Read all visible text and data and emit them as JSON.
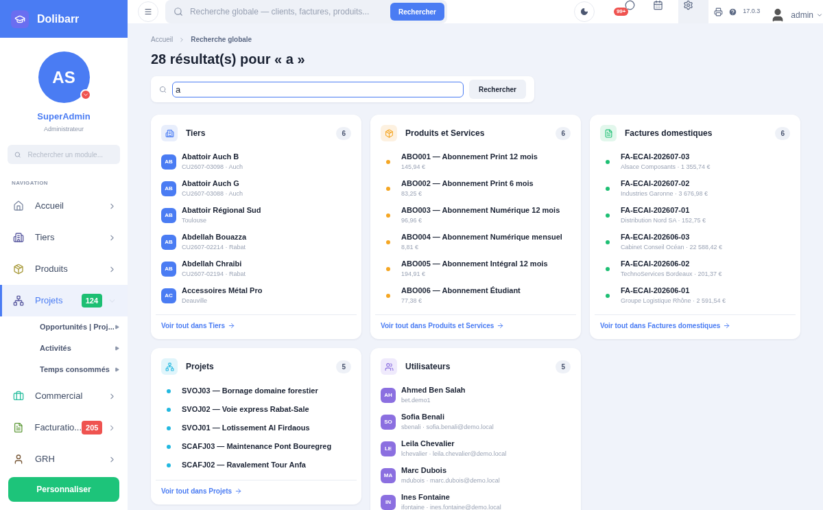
{
  "brand": {
    "name": "Dolibarr"
  },
  "topbar": {
    "search_placeholder": "Recherche globale — clients, factures, produits...",
    "search_button": "Rechercher",
    "messages_badge": "99+",
    "version": "17.0.3",
    "user": "admin"
  },
  "profile": {
    "initials": "AS",
    "name": "SuperAdmin",
    "role": "Administrateur"
  },
  "sidebar": {
    "search_placeholder": "Rechercher un module...",
    "section": "NAVIGATION",
    "button": "Personnaliser",
    "items": [
      {
        "kind": "home",
        "label": "Accueil",
        "selected": false
      },
      {
        "kind": "building",
        "label": "Tiers",
        "selected": false
      },
      {
        "kind": "box",
        "label": "Produits",
        "selected": false
      },
      {
        "kind": "project",
        "label": "Projets",
        "selected": true,
        "expanded": true,
        "badge": "124",
        "color": "#1dbf73",
        "children": [
          {
            "label": "Opportunités | Proj..."
          },
          {
            "label": "Activités"
          },
          {
            "label": "Temps consommés"
          }
        ]
      },
      {
        "kind": "briefcase",
        "label": "Commercial",
        "selected": false
      },
      {
        "kind": "invoice",
        "label": "Facturatio...",
        "selected": false,
        "badge": "205",
        "color": "#ef5350"
      },
      {
        "kind": "person",
        "label": "GRH",
        "selected": false
      }
    ]
  },
  "breadcrumb": [
    "Accueil",
    "Recherche globale"
  ],
  "title": "28 résultat(s) pour « a »",
  "search": {
    "value": "a",
    "button": "Rechercher"
  },
  "groups": [
    {
      "kind": "building",
      "title": "Tiers",
      "count": "6",
      "link": "Voir tout dans Tiers",
      "color": "#4a7cf3",
      "items": [
        {
          "kind": "avatar",
          "initials": "AB",
          "title": "Abattoir Auch B",
          "subtitle": "CU2607-03098 · Auch"
        },
        {
          "kind": "avatar",
          "initials": "AB",
          "title": "Abattoir Auch G",
          "subtitle": "CU2607-03088 · Auch"
        },
        {
          "kind": "avatar",
          "initials": "AB",
          "title": "Abattoir Régional Sud",
          "subtitle": "Toulouse"
        },
        {
          "kind": "avatar",
          "initials": "AB",
          "title": "Abdellah Bouazza",
          "subtitle": "CU2607-02214 · Rabat"
        },
        {
          "kind": "avatar",
          "initials": "AB",
          "title": "Abdellah Chraibi",
          "subtitle": "CU2607-02194 · Rabat"
        },
        {
          "kind": "avatar",
          "initials": "AC",
          "title": "Accessoires Métal Pro",
          "subtitle": "Deauville"
        }
      ]
    },
    {
      "kind": "box",
      "title": "Produits et Services",
      "count": "6",
      "link": "Voir tout dans Produits et Services",
      "color": "#f5a623",
      "items": [
        {
          "kind": "dot",
          "title": "ABO001 — Abonnement Print 12 mois",
          "subtitle": "145,94 €"
        },
        {
          "kind": "dot",
          "title": "ABO002 — Abonnement Print 6 mois",
          "subtitle": "83,25 €"
        },
        {
          "kind": "dot",
          "title": "ABO003 — Abonnement Numérique 12 mois",
          "subtitle": "96,96 €"
        },
        {
          "kind": "dot",
          "title": "ABO004 — Abonnement Numérique mensuel",
          "subtitle": "8,81 €"
        },
        {
          "kind": "dot",
          "title": "ABO005 — Abonnement Intégral 12 mois",
          "subtitle": "194,91 €"
        },
        {
          "kind": "dot",
          "title": "ABO006 — Abonnement Étudiant",
          "subtitle": "77,38 €"
        }
      ]
    },
    {
      "kind": "invoice",
      "title": "Factures domestiques",
      "count": "6",
      "link": "Voir tout dans Factures domestiques",
      "color": "#1dbf73",
      "items": [
        {
          "kind": "dot",
          "title": "FA-ECAI-202607-03",
          "subtitle": "Alsace Composants · 1 355,74 €"
        },
        {
          "kind": "dot",
          "title": "FA-ECAI-202607-02",
          "subtitle": "Industries Garonne · 3 676,98 €"
        },
        {
          "kind": "dot",
          "title": "FA-ECAI-202607-01",
          "subtitle": "Distribution Nord SA · 152,75 €"
        },
        {
          "kind": "dot",
          "title": "FA-ECAI-202606-03",
          "subtitle": "Cabinet Conseil Océan · 22 588,42 €"
        },
        {
          "kind": "dot",
          "title": "FA-ECAI-202606-02",
          "subtitle": "TechnoServices Bordeaux · 201,37 €"
        },
        {
          "kind": "dot",
          "title": "FA-ECAI-202606-01",
          "subtitle": "Groupe Logistique Rhône · 2 591,54 €"
        }
      ]
    },
    {
      "kind": "project",
      "title": "Projets",
      "count": "5",
      "link": "Voir tout dans Projets",
      "color": "#22b8e0",
      "items": [
        {
          "kind": "dot",
          "title": "SVOJ03 — Bornage domaine forestier"
        },
        {
          "kind": "dot",
          "title": "SVOJ02 — Voie express Rabat-Sale"
        },
        {
          "kind": "dot",
          "title": "SVOJ01 — Lotissement Al Firdaous"
        },
        {
          "kind": "dot",
          "title": "SCAFJ03 — Maintenance Pont Bouregreg"
        },
        {
          "kind": "dot",
          "title": "SCAFJ02 — Ravalement Tour Anfa"
        }
      ]
    },
    {
      "kind": "users",
      "title": "Utilisateurs",
      "count": "5",
      "color": "#8b6fe0",
      "items": [
        {
          "kind": "avatar",
          "initials": "AH",
          "title": "Ahmed Ben Salah",
          "subtitle": "bet.demo1"
        },
        {
          "kind": "avatar",
          "initials": "SO",
          "title": "Sofia Benali",
          "subtitle": "sbenali · sofia.benali@demo.local"
        },
        {
          "kind": "avatar",
          "initials": "LE",
          "title": "Leila Chevalier",
          "subtitle": "lchevalier · leila.chevalier@demo.local"
        },
        {
          "kind": "avatar",
          "initials": "MA",
          "title": "Marc Dubois",
          "subtitle": "mdubois · marc.dubois@demo.local"
        },
        {
          "kind": "avatar",
          "initials": "IN",
          "title": "Ines Fontaine",
          "subtitle": "ifontaine · ines.fontaine@demo.local"
        }
      ]
    }
  ]
}
